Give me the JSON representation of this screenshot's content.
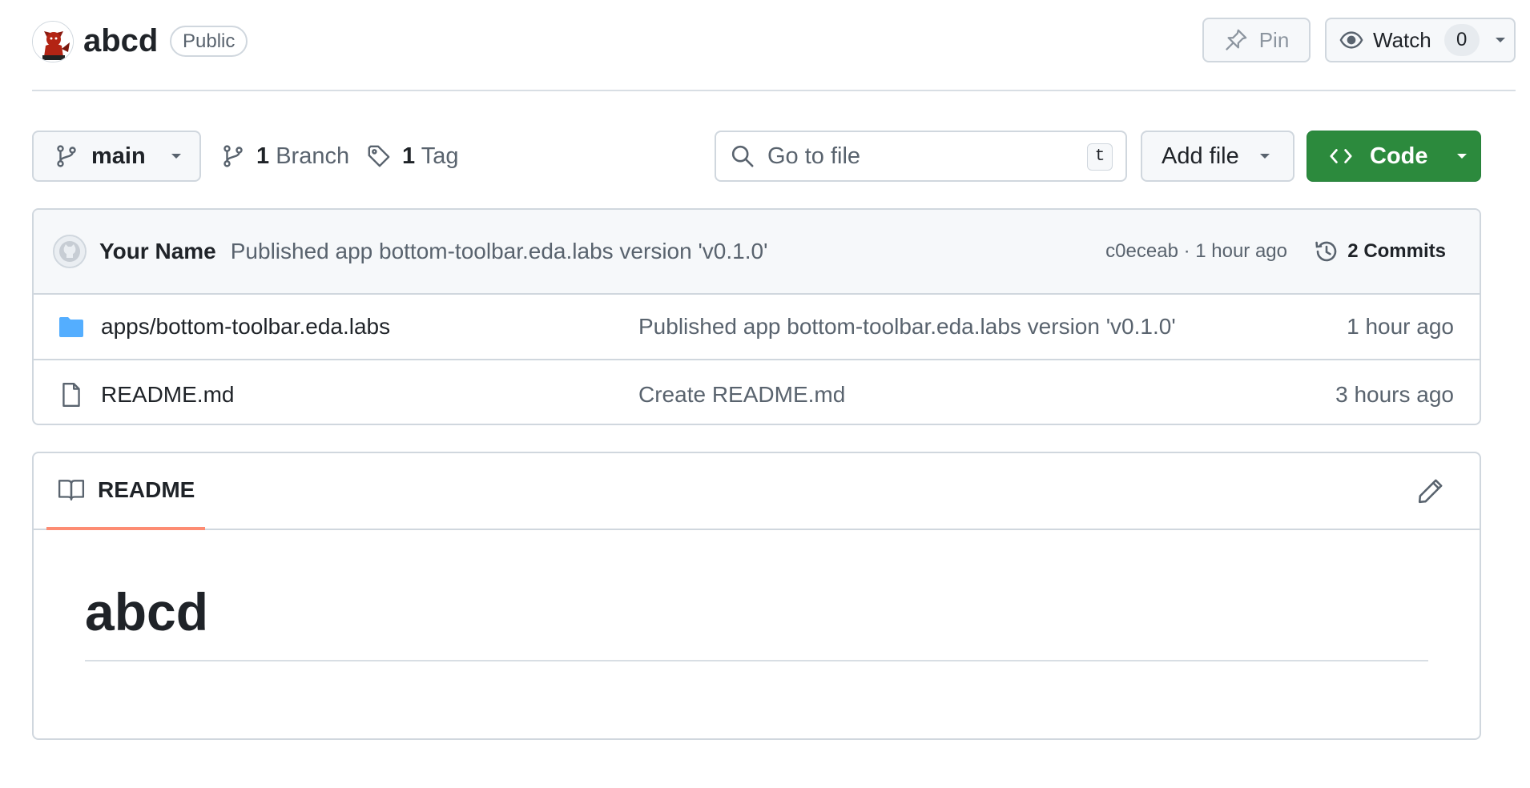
{
  "repo": {
    "name": "abcd",
    "visibility": "Public"
  },
  "actions": {
    "pin_label": "Pin",
    "watch_label": "Watch",
    "watch_count": "0"
  },
  "toolbar": {
    "branch": "main",
    "branch_count": "1",
    "branch_label": "Branch",
    "tag_count": "1",
    "tag_label": "Tag",
    "search_placeholder": "Go to file",
    "search_shortcut": "t",
    "add_file_label": "Add file",
    "code_label": "Code"
  },
  "latest_commit": {
    "author": "Your Name",
    "message": "Published app bottom-toolbar.eda.labs version 'v0.1.0'",
    "meta": "c0eceab · 1 hour ago",
    "commits_label": "2 Commits"
  },
  "files": [
    {
      "type": "folder",
      "name": "apps/bottom-toolbar.eda.labs",
      "commit": "Published app bottom-toolbar.eda.labs version 'v0.1.0'",
      "date": "1 hour ago"
    },
    {
      "type": "file",
      "name": "README.md",
      "commit": "Create README.md",
      "date": "3 hours ago"
    }
  ],
  "readme": {
    "tab_label": "README",
    "heading": "abcd"
  },
  "colors": {
    "primary_button": "#2c8a3d",
    "folder_icon": "#54aeff",
    "tab_underline": "#fd8c73",
    "border": "#d0d7de",
    "muted_text": "#59636e"
  },
  "icons": {
    "repo_avatar": "devil-avatar-icon",
    "pin": "pin-icon",
    "watch": "eye-icon",
    "branch": "git-branch-icon",
    "tag": "tag-icon",
    "search": "search-icon",
    "code": "code-icon",
    "history": "history-icon",
    "folder": "folder-icon",
    "file": "file-icon",
    "readme": "book-icon",
    "edit": "pencil-icon"
  }
}
